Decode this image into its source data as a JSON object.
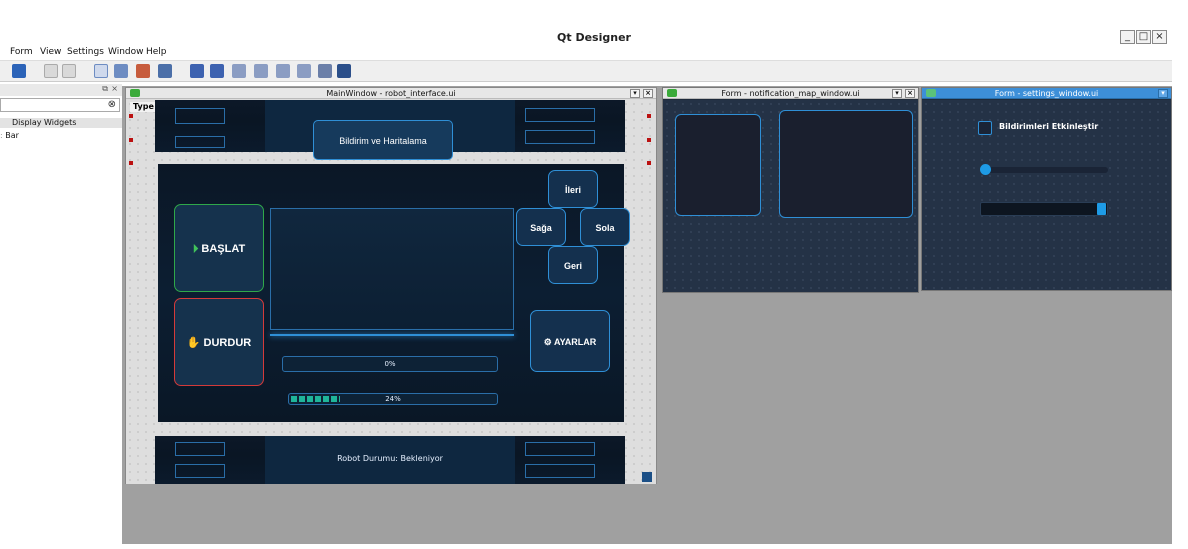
{
  "app": {
    "title": "Qt Designer",
    "window_controls": [
      "_",
      "□",
      "×"
    ]
  },
  "menu": [
    "Form",
    "View",
    "Settings",
    "Window",
    "Help"
  ],
  "widget_box": {
    "group": "Display Widgets",
    "item": "Bar"
  },
  "main_window": {
    "title": "MainWindow - robot_interface.ui",
    "type_label": "Type",
    "header_label": "Bildirim ve  Haritalama",
    "start_button": "BAŞLAT",
    "stop_button": "DURDUR",
    "forward_button": "İleri",
    "right_button": "Sağa",
    "left_button": "Sola",
    "back_button": "Geri",
    "settings_button": "AYARLAR",
    "progress1": {
      "text": "0%",
      "value": 0
    },
    "progress2": {
      "text": "24%",
      "value": 24
    },
    "status_text": "Robot Durumu: Bekleniyor"
  },
  "notification_window": {
    "title": "Form - notification_map_window.ui"
  },
  "settings_window": {
    "title": "Form - settings_window.ui",
    "checkbox_label": "Bildirimleri Etkinleştir",
    "slider_value": 0,
    "progress_value": 100
  },
  "colors": {
    "accent_blue": "#2f8fd6",
    "start_green": "#2fa84a",
    "stop_red": "#d43a3a",
    "dark_bg": "#0c1828",
    "progress_teal": "#1fb59a"
  }
}
